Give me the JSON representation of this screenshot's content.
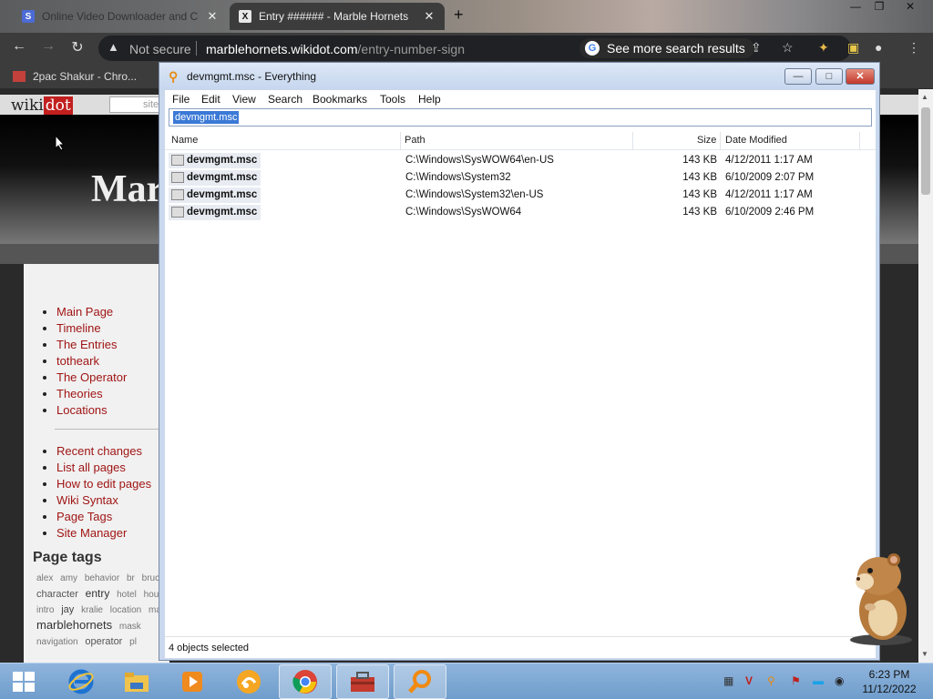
{
  "browser": {
    "tabs": [
      {
        "title": "Online Video Downloader and C",
        "favicon": "S"
      },
      {
        "title": "Entry ###### - Marble Hornets",
        "favicon": "X"
      }
    ],
    "new_tab": "+",
    "security_label": "Not secure",
    "url_host": "marblehornets.wikidot.com",
    "url_path": "/entry-number-sign",
    "search_chip": "See more search results",
    "bookmark": "2pac Shakur - Chro..."
  },
  "site": {
    "logo_a": "wiki",
    "logo_b": "dot",
    "search_placeholder": "site",
    "hero_title": "Mar",
    "menu_primary": [
      "Main Page",
      "Timeline",
      "The Entries",
      "totheark",
      "The Operator",
      "Theories",
      "Locations"
    ],
    "menu_secondary": [
      "Recent changes",
      "List all pages",
      "How to edit pages",
      "Wiki Syntax",
      "Page Tags",
      "Site Manager"
    ],
    "tags_title": "Page tags",
    "tags": [
      "alex",
      "amy",
      "behavior",
      "br",
      "bruce",
      "character",
      "entry",
      "hotel",
      "house",
      "intro",
      "jay",
      "kralie",
      "location",
      "main",
      "marblehornets",
      "mask",
      "navigation",
      "operator",
      "pl"
    ]
  },
  "everything": {
    "title": "devmgmt.msc - Everything",
    "menu": [
      "File",
      "Edit",
      "View",
      "Search",
      "Bookmarks",
      "Tools",
      "Help"
    ],
    "search_value": "devmgmt.msc",
    "columns": [
      "Name",
      "Path",
      "Size",
      "Date Modified"
    ],
    "rows": [
      {
        "name": "devmgmt.msc",
        "path": "C:\\Windows\\SysWOW64\\en-US",
        "size": "143 KB",
        "date": "4/12/2011 1:17 AM"
      },
      {
        "name": "devmgmt.msc",
        "path": "C:\\Windows\\System32",
        "size": "143 KB",
        "date": "6/10/2009 2:07 PM"
      },
      {
        "name": "devmgmt.msc",
        "path": "C:\\Windows\\System32\\en-US",
        "size": "143 KB",
        "date": "4/12/2011 1:17 AM"
      },
      {
        "name": "devmgmt.msc",
        "path": "C:\\Windows\\SysWOW64",
        "size": "143 KB",
        "date": "6/10/2009 2:46 PM"
      }
    ],
    "status": "4 objects selected"
  },
  "taskbar": {
    "time": "6:23 PM",
    "date": "11/12/2022",
    "apps": [
      "internet-explorer-icon",
      "file-explorer-icon",
      "media-player-icon",
      "uc-browser-icon",
      "chrome-icon",
      "toolbox-icon",
      "everything-search-icon"
    ]
  },
  "colors": {
    "taskbar": "#7ea8d6",
    "accent_selection": "#3b79d6",
    "wiki_link": "#a01515"
  }
}
